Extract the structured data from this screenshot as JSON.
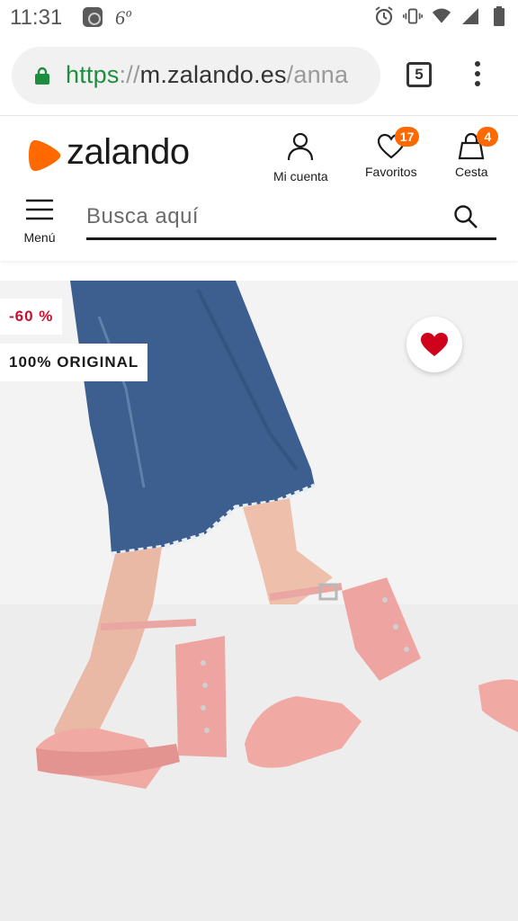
{
  "status_bar": {
    "time": "11:31",
    "temperature": "6º",
    "icons": [
      "weather-app-icon",
      "alarm-icon",
      "vibrate-icon",
      "wifi-icon",
      "signal-icon",
      "battery-icon"
    ]
  },
  "browser": {
    "url_scheme": "https",
    "url_sep": "://",
    "url_host": "m.zalando.es",
    "url_path": "/anna",
    "tab_count": "5"
  },
  "header": {
    "logo_text": "zalando",
    "account_label": "Mi cuenta",
    "favorites_label": "Favoritos",
    "favorites_count": "17",
    "cart_label": "Cesta",
    "cart_count": "4",
    "menu_label": "Menú",
    "search_placeholder": "Busca aquí"
  },
  "product": {
    "discount": "-60 %",
    "authenticity": "100% ORIGINAL"
  },
  "colors": {
    "brand_orange": "#ff6900",
    "discount_red": "#c8102e",
    "secure_green": "#1e8e3e",
    "heart_red": "#d0021b"
  }
}
